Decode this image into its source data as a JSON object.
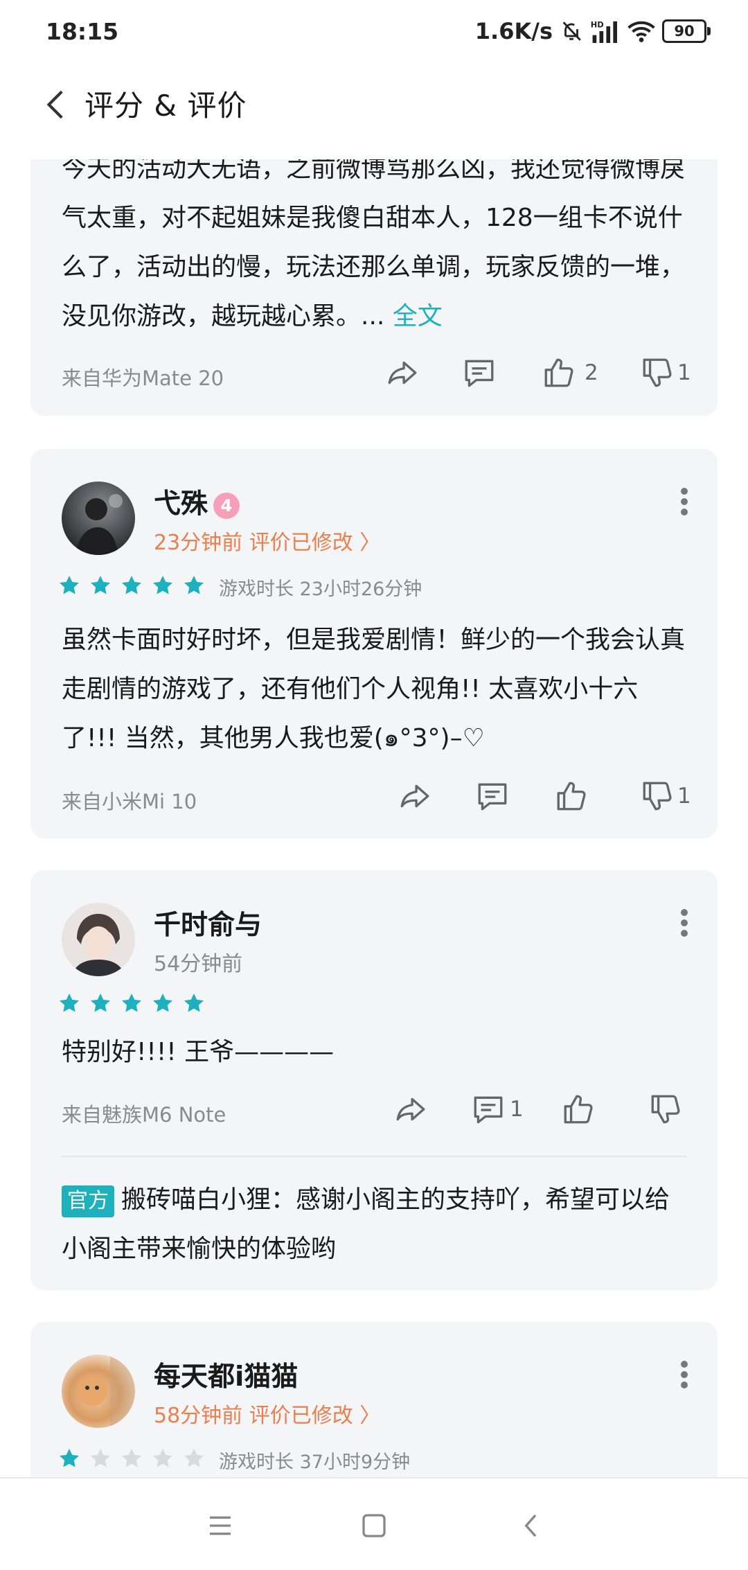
{
  "status": {
    "time": "18:15",
    "speed": "1.6K/s",
    "battery": "90"
  },
  "header": {
    "title": "评分 & 评价"
  },
  "colors": {
    "accent": "#1cb1bd",
    "meta_orange": "#e97f4e",
    "card_bg": "#f4f5f7",
    "star_filled": "#1cb1bd",
    "star_empty": "#d9dadd"
  },
  "reviews": [
    {
      "text": "今天的活动大无语，之前微博骂那么凶，我还觉得微博戾气太重，对不起姐妹是我傻白甜本人，128一组卡不说什么了，活动出的慢，玩法还那么单调，玩家反馈的一堆，没见你游改，越玩越心累。...",
      "more": "全文",
      "device": "来自华为Mate 20",
      "likes": "2",
      "dislikes": "1"
    },
    {
      "username": "弋殊",
      "level": "4",
      "time": "23分钟前 评价已修改 〉",
      "stars": 5,
      "playtime": "游戏时长 23小时26分钟",
      "text": "虽然卡面时好时坏，但是我爱剧情！鲜少的一个我会认真走剧情的游戏了，还有他们个人视角!! 太喜欢小十六了!!! 当然，其他男人我也爱(๑°3°)–♡",
      "device": "来自小米Mi 10",
      "dislikes": "1"
    },
    {
      "username": "千时俞与",
      "time": "54分钟前",
      "stars": 5,
      "text": "特别好!!!! 王爷————",
      "device": "来自魅族M6 Note",
      "comments": "1",
      "official_badge": "官方",
      "official_reply": "搬砖喵白小狸：感谢小阁主的支持吖，希望可以给小阁主带来愉快的体验哟"
    },
    {
      "username": "每天都i猫猫",
      "time": "58分钟前 评价已修改 〉",
      "stars": 1,
      "playtime": "游戏时长 37小时9分钟"
    }
  ],
  "icons": [
    "back-icon",
    "share-icon",
    "comment-icon",
    "thumb-up-icon",
    "thumb-down-icon",
    "more-vert-icon",
    "star-icon",
    "menu-icon",
    "home-icon",
    "nav-back-icon"
  ]
}
